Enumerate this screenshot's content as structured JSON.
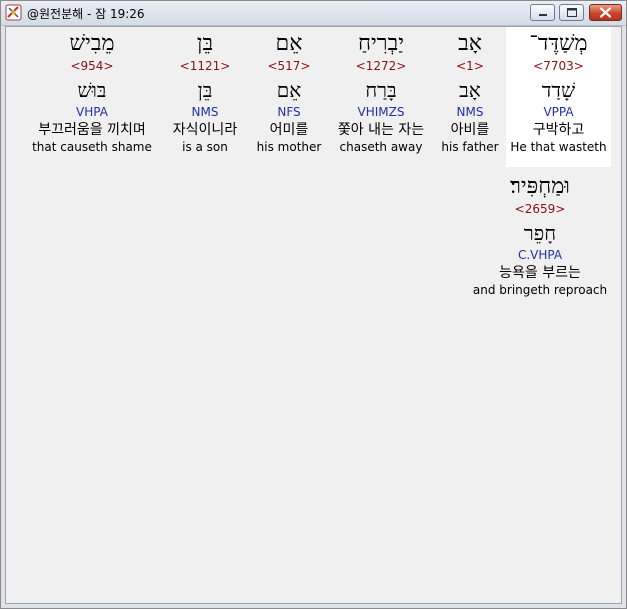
{
  "window": {
    "title": "@원전분해 - 잠 19:26"
  },
  "words": [
    {
      "hebrew": "מְשַׁדֶּד־",
      "strong": "<7703>",
      "root": "שָׁדַד",
      "parse": "VPPA",
      "korean": "구박하고",
      "english": "He that wasteth",
      "highlighted": true
    },
    {
      "hebrew": "אָב",
      "strong": "<1>",
      "root": "אָב",
      "parse": "NMS",
      "korean": "아비를",
      "english": "his father",
      "highlighted": false
    },
    {
      "hebrew": "יַבְרִיחַ",
      "strong": "<1272>",
      "root": "בָּרַח",
      "parse": "VHIMZS",
      "korean": "쫓아 내는 자는",
      "english": "chaseth away",
      "highlighted": false
    },
    {
      "hebrew": "אֵם",
      "strong": "<517>",
      "root": "אֵם",
      "parse": "NFS",
      "korean": "어미를",
      "english": "his mother",
      "highlighted": false
    },
    {
      "hebrew": "בֵּן",
      "strong": "<1121>",
      "root": "בֵּן",
      "parse": "NMS",
      "korean": "자식이니라",
      "english": "is a son",
      "highlighted": false
    },
    {
      "hebrew": "מֵבִישׁ",
      "strong": "<954>",
      "root": "בּוּשׁ",
      "parse": "VHPA",
      "korean": "부끄러움을 끼치며",
      "english": "that causeth shame",
      "highlighted": false
    },
    {
      "hebrew": "וּמַחְפִּיר׃",
      "strong": "<2659>",
      "root": "חָפֵר",
      "parse": "C.VHPA",
      "korean": "능욕을 부르는",
      "english": "and bringeth reproach",
      "highlighted": false
    }
  ]
}
